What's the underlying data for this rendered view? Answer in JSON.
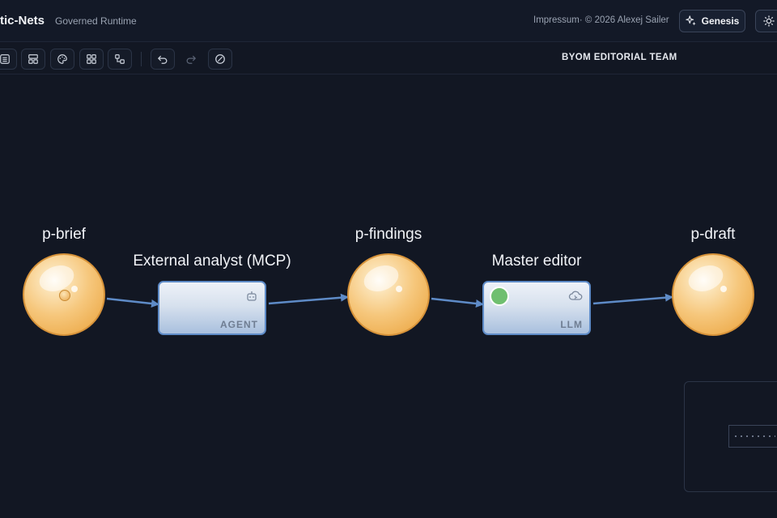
{
  "header": {
    "brand": "tic-Nets",
    "subtitle": "Governed Runtime",
    "impressum": "Impressum· © 2026 Alexej Sailer",
    "genesis_label": "Genesis"
  },
  "toolbar": {
    "team_label": "BYOM EDITORIAL TEAM",
    "icons": [
      "list-icon",
      "layout-icon",
      "palette-icon",
      "grid-icon",
      "nodes-icon",
      "undo-icon",
      "redo-icon",
      "clear-icon"
    ]
  },
  "net": {
    "places": [
      {
        "label": "p-brief",
        "tokens": 1
      },
      {
        "label": "p-findings",
        "tokens": 0
      },
      {
        "label": "p-draft",
        "tokens": 0
      }
    ],
    "transitions": [
      {
        "label": "External analyst (MCP)",
        "kind": "AGENT",
        "icon": "robot-icon",
        "enabled": false
      },
      {
        "label": "Master editor",
        "kind": "LLM",
        "icon": "cloud-ai-icon",
        "enabled": true
      }
    ]
  },
  "colors": {
    "place_fill": "#f6c77c",
    "transition_border": "#5e8bc7",
    "arc": "#5e8bc7",
    "enabled": "#6fbf6f",
    "background": "#121723"
  }
}
